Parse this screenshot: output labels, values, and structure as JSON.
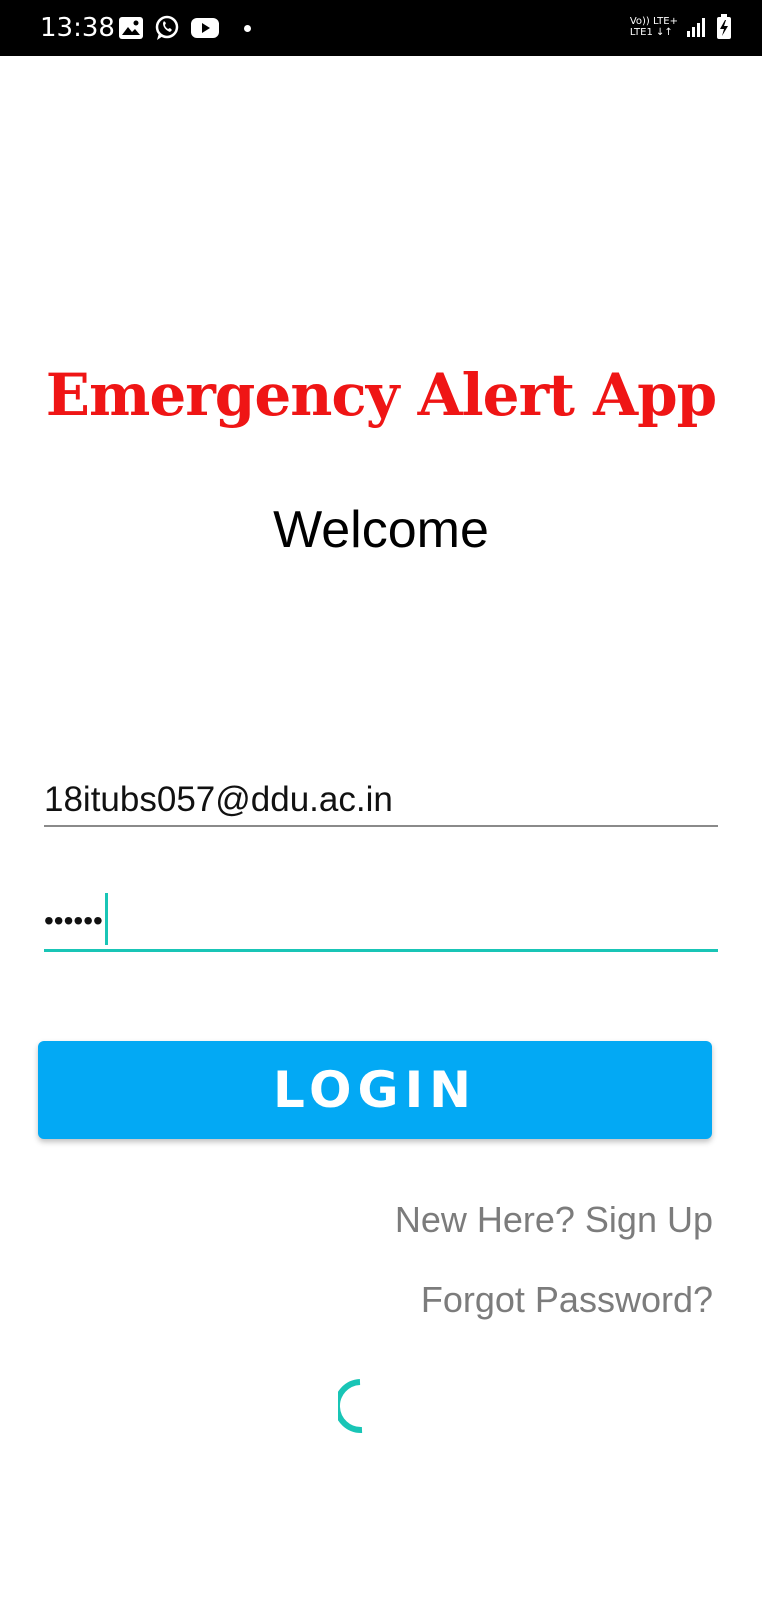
{
  "status_bar": {
    "time": "13:38",
    "network_top": "Vo)) LTE+",
    "network_bottom": "LTE1 ↓↑",
    "icons": [
      "gallery-icon",
      "whatsapp-icon",
      "youtube-icon",
      "notification-dot-icon",
      "signal-icon",
      "battery-icon"
    ]
  },
  "app": {
    "title": "Emergency Alert App",
    "title_color": "#ef1515",
    "welcome": "Welcome"
  },
  "form": {
    "email_value": "18itubs057@ddu.ac.in",
    "password_mask": "••••••",
    "accent_color": "#19c5b6"
  },
  "actions": {
    "login_label": "LOGIN",
    "login_color": "#03a9f4",
    "signup_label": "New Here? Sign Up",
    "forgot_label": "Forgot Password?"
  },
  "loading": {
    "spinner_icon": "progress-spinner-icon"
  }
}
